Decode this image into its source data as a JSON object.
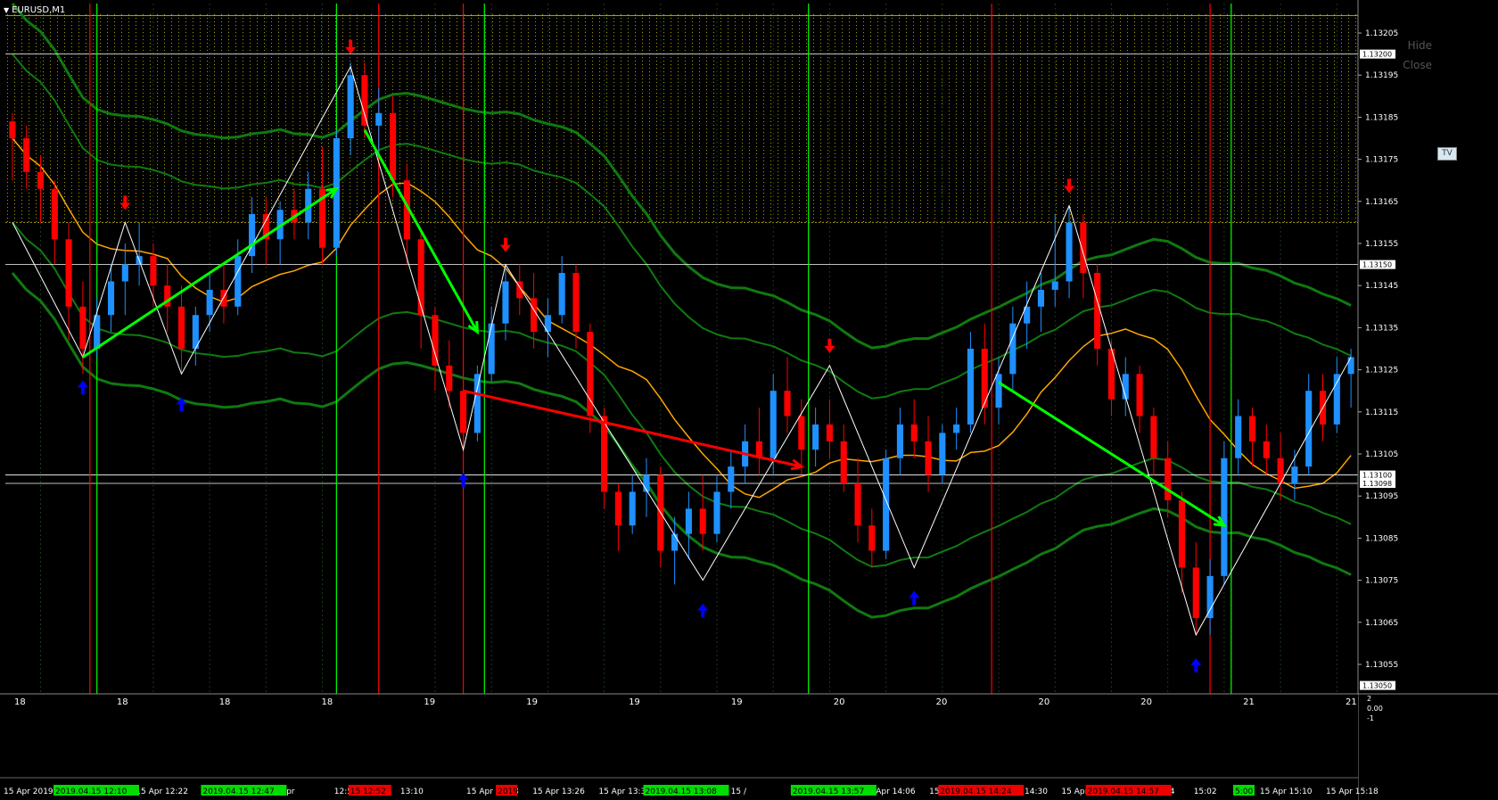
{
  "window": {
    "title": "EURUSD,M1",
    "hide_label": "Hide",
    "close_label": "Close",
    "tv_label": "TV"
  },
  "colors": {
    "background": "#000000",
    "bull_candle": "#1e90ff",
    "bear_candle": "#ff0000",
    "bollinger": "#0f7a0f",
    "moving_average": "#ffa500",
    "zigzag": "#ffffff",
    "resistance_zone": "#a8a000",
    "grid": "#1a3a1a",
    "buy_arrow": "#0000ff",
    "buy_arrow_light": "#00bfff",
    "sell_arrow": "#ff0000",
    "sell_arrow_light": "#ff88cc",
    "trend_up_arrow": "#00ff00",
    "trend_down_arrow": "#ff0000",
    "vline_green": "#00ff00",
    "vline_red": "#ff0000",
    "hline_green": "#00dd00",
    "hline_white": "#ffffff"
  },
  "chart_data": {
    "type": "candlestick",
    "symbol": "EURUSD",
    "timeframe": "M1",
    "title": "EURUSD,M1",
    "ylim": [
      1.13048,
      1.13212
    ],
    "y_ticks": [
      "1.13205",
      "1.13195",
      "1.13185",
      "1.13175",
      "1.13165",
      "1.13155",
      "1.13145",
      "1.13135",
      "1.13125",
      "1.13115",
      "1.13105",
      "1.13095",
      "1.13085",
      "1.13075",
      "1.13065",
      "1.13055"
    ],
    "price_labels": [
      {
        "text": "1.13200",
        "value": 1.132,
        "kind": "box"
      },
      {
        "text": "1.13150",
        "value": 1.1315,
        "kind": "box"
      },
      {
        "text": "1.13100",
        "value": 1.131,
        "kind": "box"
      },
      {
        "text": "1.13098",
        "value": 1.13098,
        "kind": "box"
      },
      {
        "text": "1.13050",
        "value": 1.1305,
        "kind": "box"
      }
    ],
    "x_labels": [
      "15 Apr 2019",
      "Apr 12:14",
      "15 Apr 12:22",
      "15 Apr 12:30",
      "15 Apr",
      "12:5",
      "13:10",
      "15 Apr 13:18",
      "15 Apr 13:26",
      "15 Apr 13:34",
      "15 Apr 13:42",
      "15 /",
      "3:58",
      "15 Apr 14:06",
      "15 Apr 14",
      "15 Apr 14:30",
      "15 Apr 14:38",
      "15 Apr 14:4",
      "15:02",
      "15 Apr 15:10",
      "15 Apr 15:18"
    ],
    "period_labels": [
      "18",
      "18",
      "18",
      "18",
      "19",
      "19",
      "19",
      "19",
      "20",
      "20",
      "20",
      "20",
      "21",
      "21"
    ],
    "time_badges": [
      {
        "text": "2019.04.15 12:10",
        "color": "#00dd00"
      },
      {
        "text": "2019.04.15 12:47",
        "color": "#00dd00"
      },
      {
        "text": "15 12:52",
        "color": "#ee0000"
      },
      {
        "text": "2019",
        "color": "#ee0000"
      },
      {
        "text": "2019.04.15 13:08",
        "color": "#00dd00"
      },
      {
        "text": "2019.04.15 13:57",
        "color": "#00dd00"
      },
      {
        "text": "2019.04.15 14:24",
        "color": "#ee0000"
      },
      {
        "text": "2019.04.15 14:57",
        "color": "#ee0000"
      },
      {
        "text": "5:00",
        "color": "#00dd00"
      }
    ],
    "sub_axis_labels": [
      "2",
      "0.00",
      "-1"
    ],
    "candles": [
      [
        1.13184,
        1.13186,
        1.1317,
        1.1318
      ],
      [
        1.1318,
        1.13183,
        1.13168,
        1.13172
      ],
      [
        1.13172,
        1.13176,
        1.1316,
        1.13168
      ],
      [
        1.13168,
        1.1317,
        1.1315,
        1.13156
      ],
      [
        1.13156,
        1.1316,
        1.13132,
        1.1314
      ],
      [
        1.1314,
        1.13146,
        1.13124,
        1.1313
      ],
      [
        1.1313,
        1.13142,
        1.13128,
        1.13138
      ],
      [
        1.13138,
        1.1315,
        1.13134,
        1.13146
      ],
      [
        1.13146,
        1.13155,
        1.13138,
        1.1315
      ],
      [
        1.1315,
        1.1316,
        1.13145,
        1.13152
      ],
      [
        1.13152,
        1.13155,
        1.1314,
        1.13145
      ],
      [
        1.13145,
        1.1315,
        1.13134,
        1.1314
      ],
      [
        1.1314,
        1.13145,
        1.13124,
        1.1313
      ],
      [
        1.1313,
        1.1314,
        1.13126,
        1.13138
      ],
      [
        1.13138,
        1.13148,
        1.13134,
        1.13144
      ],
      [
        1.13144,
        1.1315,
        1.13136,
        1.1314
      ],
      [
        1.1314,
        1.13156,
        1.13138,
        1.13152
      ],
      [
        1.13152,
        1.13166,
        1.13148,
        1.13162
      ],
      [
        1.13162,
        1.13166,
        1.1315,
        1.13156
      ],
      [
        1.13156,
        1.13165,
        1.1315,
        1.13163
      ],
      [
        1.13163,
        1.13168,
        1.13156,
        1.1316
      ],
      [
        1.1316,
        1.13172,
        1.13156,
        1.13168
      ],
      [
        1.13168,
        1.13178,
        1.1315,
        1.13154
      ],
      [
        1.13154,
        1.13182,
        1.13152,
        1.1318
      ],
      [
        1.1318,
        1.13198,
        1.13176,
        1.13195
      ],
      [
        1.13195,
        1.13198,
        1.1318,
        1.13183
      ],
      [
        1.13183,
        1.13192,
        1.13176,
        1.13186
      ],
      [
        1.13186,
        1.1319,
        1.13166,
        1.1317
      ],
      [
        1.1317,
        1.13174,
        1.1315,
        1.13156
      ],
      [
        1.13156,
        1.13158,
        1.1313,
        1.13138
      ],
      [
        1.13138,
        1.1314,
        1.1312,
        1.13126
      ],
      [
        1.13126,
        1.13132,
        1.13116,
        1.1312
      ],
      [
        1.1312,
        1.13124,
        1.13104,
        1.1311
      ],
      [
        1.1311,
        1.13126,
        1.13108,
        1.13124
      ],
      [
        1.13124,
        1.1314,
        1.13122,
        1.13136
      ],
      [
        1.13136,
        1.1315,
        1.13132,
        1.13146
      ],
      [
        1.13146,
        1.1315,
        1.13138,
        1.13142
      ],
      [
        1.13142,
        1.13148,
        1.1313,
        1.13134
      ],
      [
        1.13134,
        1.13142,
        1.13128,
        1.13138
      ],
      [
        1.13138,
        1.13152,
        1.13136,
        1.13148
      ],
      [
        1.13148,
        1.1315,
        1.1313,
        1.13134
      ],
      [
        1.13134,
        1.13136,
        1.1311,
        1.13114
      ],
      [
        1.13114,
        1.13116,
        1.13092,
        1.13096
      ],
      [
        1.13096,
        1.13098,
        1.13082,
        1.13088
      ],
      [
        1.13088,
        1.131,
        1.13086,
        1.13096
      ],
      [
        1.13096,
        1.13104,
        1.1309,
        1.131
      ],
      [
        1.131,
        1.13102,
        1.13078,
        1.13082
      ],
      [
        1.13082,
        1.1309,
        1.13074,
        1.13086
      ],
      [
        1.13086,
        1.13096,
        1.1308,
        1.13092
      ],
      [
        1.13092,
        1.131,
        1.13082,
        1.13086
      ],
      [
        1.13086,
        1.131,
        1.13084,
        1.13096
      ],
      [
        1.13096,
        1.13106,
        1.13092,
        1.13102
      ],
      [
        1.13102,
        1.13112,
        1.13098,
        1.13108
      ],
      [
        1.13108,
        1.13116,
        1.131,
        1.13104
      ],
      [
        1.13104,
        1.13124,
        1.131,
        1.1312
      ],
      [
        1.1312,
        1.13128,
        1.1311,
        1.13114
      ],
      [
        1.13114,
        1.13118,
        1.131,
        1.13106
      ],
      [
        1.13106,
        1.13116,
        1.13102,
        1.13112
      ],
      [
        1.13112,
        1.13118,
        1.13104,
        1.13108
      ],
      [
        1.13108,
        1.13112,
        1.13096,
        1.13098
      ],
      [
        1.13098,
        1.13104,
        1.13084,
        1.13088
      ],
      [
        1.13088,
        1.13092,
        1.13078,
        1.13082
      ],
      [
        1.13082,
        1.13106,
        1.1308,
        1.13104
      ],
      [
        1.13104,
        1.13116,
        1.131,
        1.13112
      ],
      [
        1.13112,
        1.13118,
        1.13104,
        1.13108
      ],
      [
        1.13108,
        1.13114,
        1.13096,
        1.131
      ],
      [
        1.131,
        1.13112,
        1.13098,
        1.1311
      ],
      [
        1.1311,
        1.13116,
        1.13106,
        1.13112
      ],
      [
        1.13112,
        1.13134,
        1.1311,
        1.1313
      ],
      [
        1.1313,
        1.13136,
        1.13112,
        1.13116
      ],
      [
        1.13116,
        1.13128,
        1.13112,
        1.13124
      ],
      [
        1.13124,
        1.1314,
        1.1312,
        1.13136
      ],
      [
        1.13136,
        1.13146,
        1.1313,
        1.1314
      ],
      [
        1.1314,
        1.13148,
        1.13134,
        1.13144
      ],
      [
        1.13144,
        1.13162,
        1.1314,
        1.13146
      ],
      [
        1.13146,
        1.13164,
        1.13142,
        1.1316
      ],
      [
        1.1316,
        1.13162,
        1.13142,
        1.13148
      ],
      [
        1.13148,
        1.1315,
        1.13126,
        1.1313
      ],
      [
        1.1313,
        1.13132,
        1.13114,
        1.13118
      ],
      [
        1.13118,
        1.13128,
        1.13114,
        1.13124
      ],
      [
        1.13124,
        1.13126,
        1.1311,
        1.13114
      ],
      [
        1.13114,
        1.13116,
        1.131,
        1.13104
      ],
      [
        1.13104,
        1.13108,
        1.1309,
        1.13094
      ],
      [
        1.13094,
        1.13096,
        1.13072,
        1.13078
      ],
      [
        1.13078,
        1.13084,
        1.13062,
        1.13066
      ],
      [
        1.13066,
        1.1308,
        1.13062,
        1.13076
      ],
      [
        1.13076,
        1.13108,
        1.13074,
        1.13104
      ],
      [
        1.13104,
        1.13118,
        1.131,
        1.13114
      ],
      [
        1.13114,
        1.13116,
        1.13102,
        1.13108
      ],
      [
        1.13108,
        1.13112,
        1.131,
        1.13104
      ],
      [
        1.13104,
        1.1311,
        1.13094,
        1.13098
      ],
      [
        1.13098,
        1.13106,
        1.13094,
        1.13102
      ],
      [
        1.13102,
        1.13124,
        1.131,
        1.1312
      ],
      [
        1.1312,
        1.13124,
        1.13108,
        1.13112
      ],
      [
        1.13112,
        1.13128,
        1.1311,
        1.13124
      ],
      [
        1.13124,
        1.1313,
        1.13116,
        1.13128
      ]
    ],
    "zigzag": [
      [
        0,
        1.1316
      ],
      [
        5,
        1.13128
      ],
      [
        8,
        1.1316
      ],
      [
        12,
        1.13124
      ],
      [
        24,
        1.13197
      ],
      [
        32,
        1.13106
      ],
      [
        35,
        1.1315
      ],
      [
        49,
        1.13075
      ],
      [
        58,
        1.13126
      ],
      [
        64,
        1.13078
      ],
      [
        75,
        1.13164
      ],
      [
        84,
        1.13062
      ],
      [
        95,
        1.13128
      ]
    ],
    "trend_arrows": [
      {
        "from": [
          5,
          1.13128
        ],
        "to": [
          23,
          1.13168
        ],
        "color": "green"
      },
      {
        "from": [
          25,
          1.13182
        ],
        "to": [
          33,
          1.13134
        ],
        "color": "green"
      },
      {
        "from": [
          32,
          1.1312
        ],
        "to": [
          56,
          1.13102
        ],
        "color": "red"
      },
      {
        "from": [
          70,
          1.13122
        ],
        "to": [
          86,
          1.13088
        ],
        "color": "green"
      }
    ],
    "horizontal_lines": [
      {
        "value": 1.132,
        "color": "white"
      },
      {
        "value": 1.1315,
        "color": "white"
      },
      {
        "value": 1.131,
        "color": "white"
      },
      {
        "value": 1.13098,
        "color": "white"
      }
    ],
    "resistance_zone": [
      1.1316,
      1.1321
    ],
    "vertical_lines": [
      {
        "index": 5.5,
        "color": "red"
      },
      {
        "index": 6,
        "color": "green"
      },
      {
        "index": 23,
        "color": "green"
      },
      {
        "index": 26,
        "color": "red"
      },
      {
        "index": 32,
        "color": "red"
      },
      {
        "index": 33.5,
        "color": "green"
      },
      {
        "index": 56.5,
        "color": "green"
      },
      {
        "index": 69.5,
        "color": "red"
      },
      {
        "index": 85,
        "color": "red"
      },
      {
        "index": 86.5,
        "color": "green"
      }
    ]
  }
}
